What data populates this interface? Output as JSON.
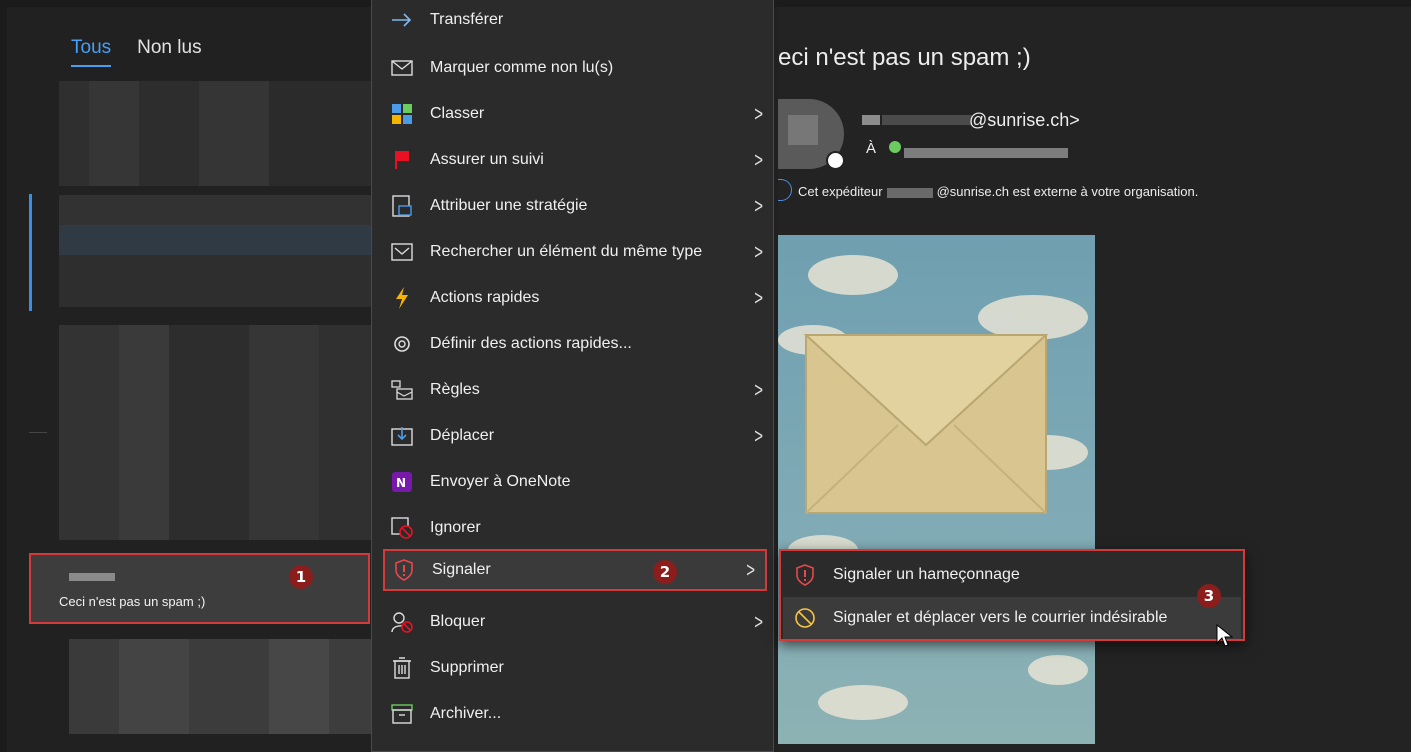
{
  "tabs": [
    {
      "label": "Tous",
      "active": true
    },
    {
      "label": "Non lus",
      "active": false
    }
  ],
  "selected_message": {
    "subject": "Ceci n'est pas un spam ;)"
  },
  "reading": {
    "subject": "eci n'est pas un spam ;)",
    "from_domain": "@sunrise.ch>",
    "to_label": "À",
    "external_notice_start": "Cet expéditeur",
    "external_notice_end": "@sunrise.ch est externe à votre organisation."
  },
  "menu": {
    "items": [
      {
        "label": "Transférer",
        "icon": "forward-arrow-icon"
      },
      {
        "label": "Marquer comme non lu(s)",
        "icon": "envelope-icon"
      },
      {
        "label": "Classer",
        "icon": "categorize-icon",
        "submenu": true
      },
      {
        "label": "Assurer un suivi",
        "icon": "flag-icon",
        "submenu": true
      },
      {
        "label": "Attribuer une stratégie",
        "icon": "policy-icon",
        "submenu": true
      },
      {
        "label": "Rechercher un élément du même type",
        "icon": "find-related-icon",
        "submenu": true
      },
      {
        "label": "Actions rapides",
        "icon": "lightning-icon",
        "submenu": true
      },
      {
        "label": "Définir des actions rapides...",
        "icon": "gear-icon"
      },
      {
        "label": "Règles",
        "icon": "rules-icon",
        "submenu": true
      },
      {
        "label": "Déplacer",
        "icon": "move-icon",
        "submenu": true
      },
      {
        "label": "Envoyer à OneNote",
        "icon": "onenote-icon"
      },
      {
        "label": "Ignorer",
        "icon": "ignore-icon"
      },
      {
        "label": "Signaler",
        "icon": "shield-alert-icon",
        "submenu": true,
        "highlighted": true
      },
      {
        "label": "Bloquer",
        "icon": "block-person-icon",
        "submenu": true
      },
      {
        "label": "Supprimer",
        "icon": "trash-icon"
      },
      {
        "label": "Archiver...",
        "icon": "archive-icon"
      }
    ]
  },
  "submenu": {
    "items": [
      {
        "label": "Signaler un hameçonnage",
        "icon": "shield-alert-icon"
      },
      {
        "label": "Signaler et déplacer vers le courrier indésirable",
        "icon": "prohibited-icon"
      }
    ]
  },
  "badges": [
    "1",
    "2",
    "3"
  ],
  "colors": {
    "accent": "#479ef5",
    "highlight_border": "#d43a3a",
    "badge": "#8b1d1d",
    "flag": "#e81123"
  }
}
